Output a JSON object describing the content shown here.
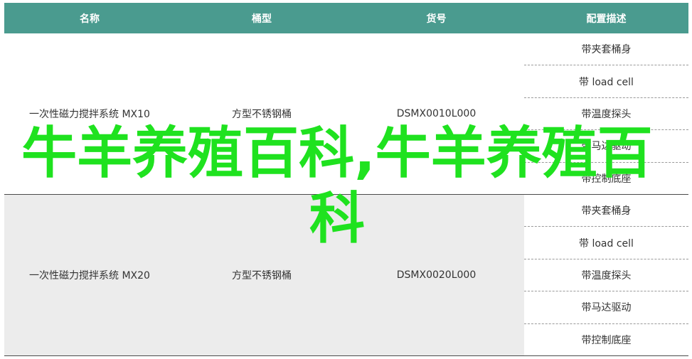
{
  "table": {
    "headers": [
      "名称",
      "桶型",
      "货号",
      "配置描述"
    ],
    "rows": [
      {
        "name": "一次性磁力搅拌系统 MX10",
        "bucket": "方型不锈钢桶",
        "sku": "DSMX0010L000",
        "configs": [
          "带夹套桶身",
          "带 load cell",
          "带温度探头",
          "带马达驱动",
          "带控制底座"
        ]
      },
      {
        "name": "一次性磁力搅拌系统 MX20",
        "bucket": "方型不锈钢桶",
        "sku": "DSMX0020L000",
        "configs": [
          "带夹套桶身",
          "带 load cell",
          "带温度探头",
          "带马达驱动",
          "带控制底座"
        ]
      }
    ]
  },
  "watermark": {
    "text": "牛羊养殖百科,牛羊养殖百科",
    "color": "#1fe21f"
  },
  "colors": {
    "header_bg": "#4a9b8f",
    "row_alt_bg": "#ececec"
  }
}
